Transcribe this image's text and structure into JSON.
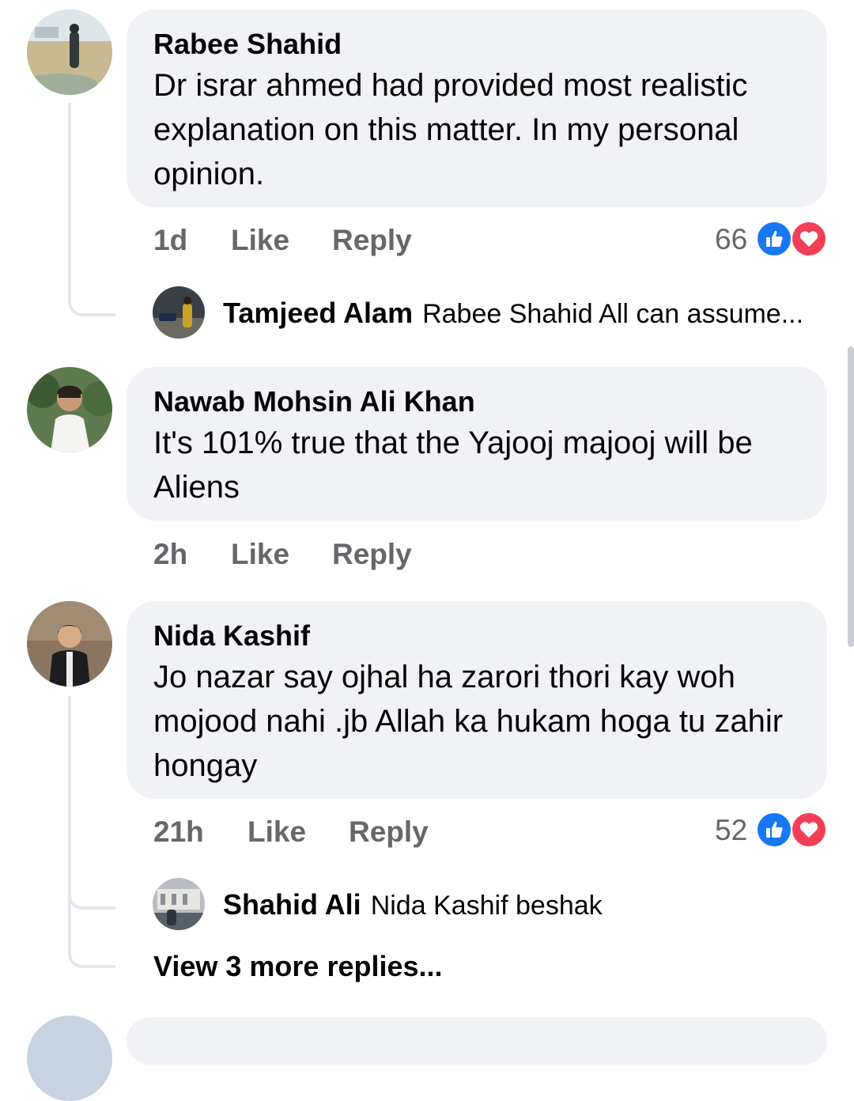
{
  "comments": [
    {
      "author": "Rabee Shahid",
      "text": "Dr israr ahmed had provided most realistic explanation on this matter. In my personal opinion.",
      "time": "1d",
      "like_label": "Like",
      "reply_label": "Reply",
      "reaction_count": "66",
      "reactions": [
        "like-reaction-icon",
        "love-reaction-icon"
      ],
      "reply": {
        "author": "Tamjeed Alam",
        "text": "Rabee Shahid All can assume..."
      }
    },
    {
      "author": "Nawab Mohsin Ali Khan",
      "text": "It's 101% true that the Yajooj majooj will be Aliens",
      "time": "2h",
      "like_label": "Like",
      "reply_label": "Reply"
    },
    {
      "author": "Nida Kashif",
      "text": "Jo nazar say ojhal ha zarori thori kay woh mojood nahi .jb Allah ka hukam hoga tu zahir hongay",
      "time": "21h",
      "like_label": "Like",
      "reply_label": "Reply",
      "reaction_count": "52",
      "reactions": [
        "like-reaction-icon",
        "love-reaction-icon"
      ],
      "reply": {
        "author": "Shahid Ali",
        "text": "Nida Kashif beshak"
      },
      "more_replies_label": "View 3 more replies..."
    }
  ],
  "colors": {
    "bubble": "#f0f2f5",
    "meta_text": "#65676b",
    "like_blue": "#1877f2",
    "love_red": "#f33e58",
    "thread_line": "#e4e6eb"
  }
}
